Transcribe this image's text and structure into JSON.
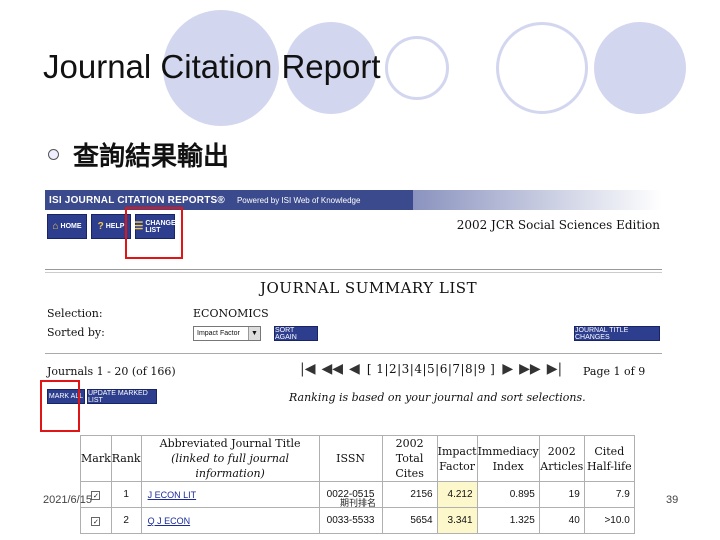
{
  "slide": {
    "title": "Journal Citation Report",
    "bullet": "查詢結果輸出",
    "footer_date": "2021/6/15",
    "footer_page": "39",
    "footer_mid": "期刊排名"
  },
  "jcr": {
    "brand": "ISI JOURNAL CITATION REPORTS®",
    "powered_by": "Powered by ISI Web of Knowledge",
    "nav_buttons": [
      "HOME",
      "HELP",
      "CHANGE LIST"
    ],
    "edition": "2002 JCR Social Sciences Edition",
    "summary_title": "JOURNAL SUMMARY LIST",
    "selection_label": "Selection:",
    "selection_value": "ECONOMICS",
    "sorted_label": "Sorted by:",
    "sort_value": "Impact Factor",
    "sort_again_label": "SORT AGAIN",
    "journal_title_changes_label": "JOURNAL TITLE CHANGES",
    "journals_range": "Journals 1 - 20 (of 166)",
    "pages_text": "[ 1|2|3|4|5|6|7|8|9 ]",
    "page_of": "Page 1 of 9",
    "mark_all_label": "MARK ALL",
    "update_marked_label": "UPDATE MARKED LIST",
    "ranking_note": "Ranking is based on your journal and sort selections.",
    "table": {
      "headers": {
        "mark": "Mark",
        "rank": "Rank",
        "title_1": "Abbreviated Journal Title",
        "title_2": "(linked to full journal information)",
        "issn": "ISSN",
        "cites_1": "2002",
        "cites_2": "Total Cites",
        "impact_1": "Impact",
        "impact_2": "Factor",
        "immediacy_1": "Immediacy",
        "immediacy_2": "Index",
        "articles_1": "2002",
        "articles_2": "Articles",
        "halflife_1": "Cited",
        "halflife_2": "Half-life"
      },
      "rows": [
        {
          "rank": "1",
          "title": "J ECON LIT",
          "issn": "0022-0515",
          "cites": "2156",
          "impact": "4.212",
          "immediacy": "0.895",
          "articles": "19",
          "halflife": "7.9"
        },
        {
          "rank": "2",
          "title": "Q J ECON",
          "issn": "0033-5533",
          "cites": "5654",
          "impact": "3.341",
          "immediacy": "1.325",
          "articles": "40",
          "halflife": ">10.0"
        }
      ]
    }
  },
  "colors": {
    "decor_circle": "#d3d6ef",
    "highlight_box": "#e01515",
    "jcr_blue": "#2d3e8e"
  }
}
